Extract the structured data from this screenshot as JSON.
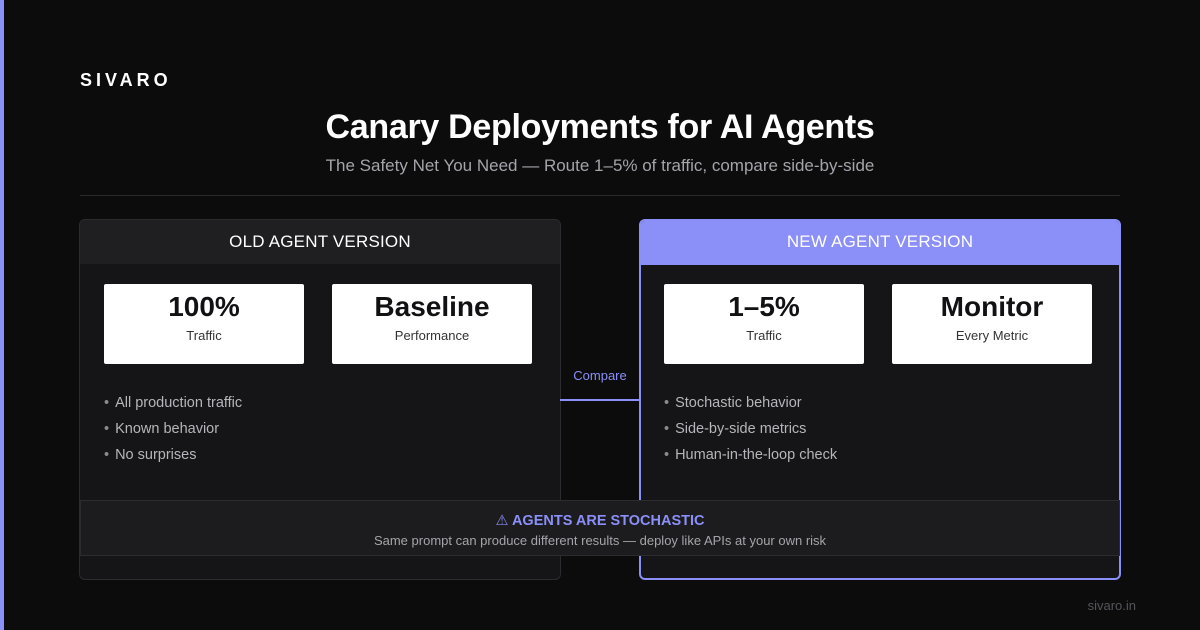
{
  "brand": "SIVARO",
  "title": "Canary Deployments for AI Agents",
  "subtitle": "The Safety Net You Need — Route 1–5% of traffic, compare side-by-side",
  "old_panel": {
    "header": "OLD AGENT VERSION",
    "stats": [
      {
        "value": "100%",
        "label": "Traffic"
      },
      {
        "value": "Baseline",
        "label": "Performance"
      }
    ],
    "bullets": [
      "All production traffic",
      "Known behavior",
      "No surprises"
    ]
  },
  "new_panel": {
    "header": "NEW AGENT VERSION",
    "stats": [
      {
        "value": "1–5%",
        "label": "Traffic"
      },
      {
        "value": "Monitor",
        "label": "Every Metric"
      }
    ],
    "bullets": [
      "Stochastic behavior",
      "Side-by-side metrics",
      "Human-in-the-loop check"
    ]
  },
  "connector_label": "Compare",
  "warning": {
    "icon": "warning-icon",
    "title": "⚠ AGENTS ARE STOCHASTIC",
    "text": "Same prompt can produce different results — deploy like APIs at your own risk"
  },
  "footer": "sivaro.in",
  "colors": {
    "accent": "#8b8ff8",
    "background": "#0c0c0d",
    "panel": "#151517"
  }
}
